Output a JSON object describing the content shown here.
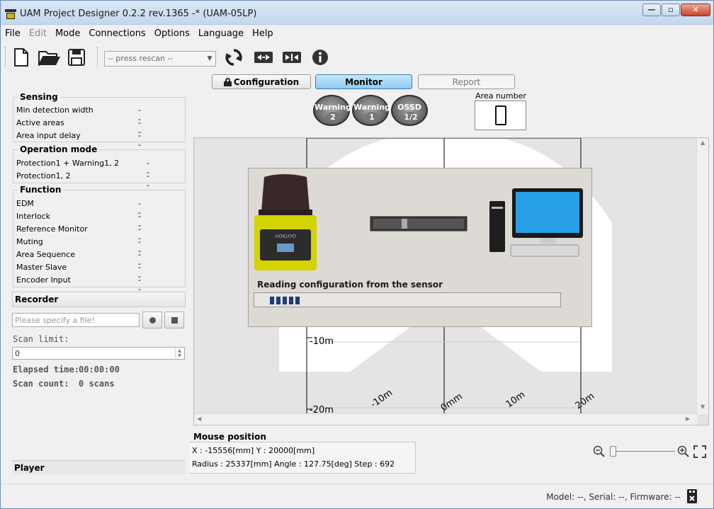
{
  "window": {
    "title": "UAM Project Designer 0.2.2 rev.1365 -* (UAM-05LP)",
    "minimize_glyph": "—",
    "maximize_glyph": "▫",
    "close_glyph": "✕"
  },
  "menu": {
    "items": [
      {
        "label": "File",
        "enabled": true
      },
      {
        "label": "Edit",
        "enabled": false
      },
      {
        "label": "Mode",
        "enabled": true
      },
      {
        "label": "Connections",
        "enabled": true
      },
      {
        "label": "Options",
        "enabled": true
      },
      {
        "label": "Language",
        "enabled": true
      },
      {
        "label": "Help",
        "enabled": true
      }
    ]
  },
  "toolbar": {
    "port_combo": "-- press rescan --",
    "icons": [
      "new-file-icon",
      "open-folder-icon",
      "save-icon",
      "rescan-icon",
      "connect-icon",
      "disconnect-icon",
      "info-icon"
    ]
  },
  "tabs": {
    "configuration": "Configuration",
    "monitor": "Monitor",
    "report": "Report",
    "active": "monitor"
  },
  "sensing": {
    "title": "Sensing",
    "rows": [
      {
        "label": "Min detection width",
        "value": "--"
      },
      {
        "label": "Active areas",
        "value": "--"
      },
      {
        "label": "Area input delay",
        "value": "--"
      }
    ]
  },
  "operation_mode": {
    "title": "Operation mode",
    "rows": [
      {
        "label": "Protection1 + Warning1, 2",
        "value": "--"
      },
      {
        "label": "Protection1, 2",
        "value": "--"
      }
    ]
  },
  "function": {
    "title": "Function",
    "rows": [
      {
        "label": "EDM",
        "value": "--"
      },
      {
        "label": "Interlock",
        "value": "--"
      },
      {
        "label": "Reference Monitor",
        "value": "--"
      },
      {
        "label": "Muting",
        "value": "--"
      },
      {
        "label": "Area Sequence",
        "value": "--"
      },
      {
        "label": "Master Slave",
        "value": "--"
      },
      {
        "label": "Encoder Input",
        "value": "--"
      }
    ]
  },
  "recorder": {
    "title": "Recorder",
    "file_placeholder": "Please specify a file!",
    "scan_limit_label": "Scan limit:",
    "scan_limit_value": "0",
    "elapsed_label": "Elapsed time:",
    "elapsed_value": "00:00:00",
    "scan_count_label": "Scan count:",
    "scan_count_value": "0 scans"
  },
  "player": {
    "title": "Player"
  },
  "indicators": [
    {
      "label": "Warning",
      "value": "2"
    },
    {
      "label": "Warning",
      "value": "1"
    },
    {
      "label": "OSSD",
      "value": "1/2"
    }
  ],
  "area_number": {
    "label": "Area number",
    "value": "0"
  },
  "plot": {
    "labels": [
      "-10m",
      "-20m",
      "-10m",
      "0mm",
      "10m",
      "20m"
    ]
  },
  "dialog": {
    "message": "Reading configuration from the sensor",
    "sensor_brand": "HOKUYO",
    "progress_blocks": 5
  },
  "mouse": {
    "title": "Mouse position",
    "line1": "X : -15556[mm]       Y : 20000[mm]",
    "line2": "Radius : 25337[mm]  Angle : 127.75[deg]  Step : 692"
  },
  "status": {
    "text": "Model: --, Serial: --, Firmware: --"
  }
}
